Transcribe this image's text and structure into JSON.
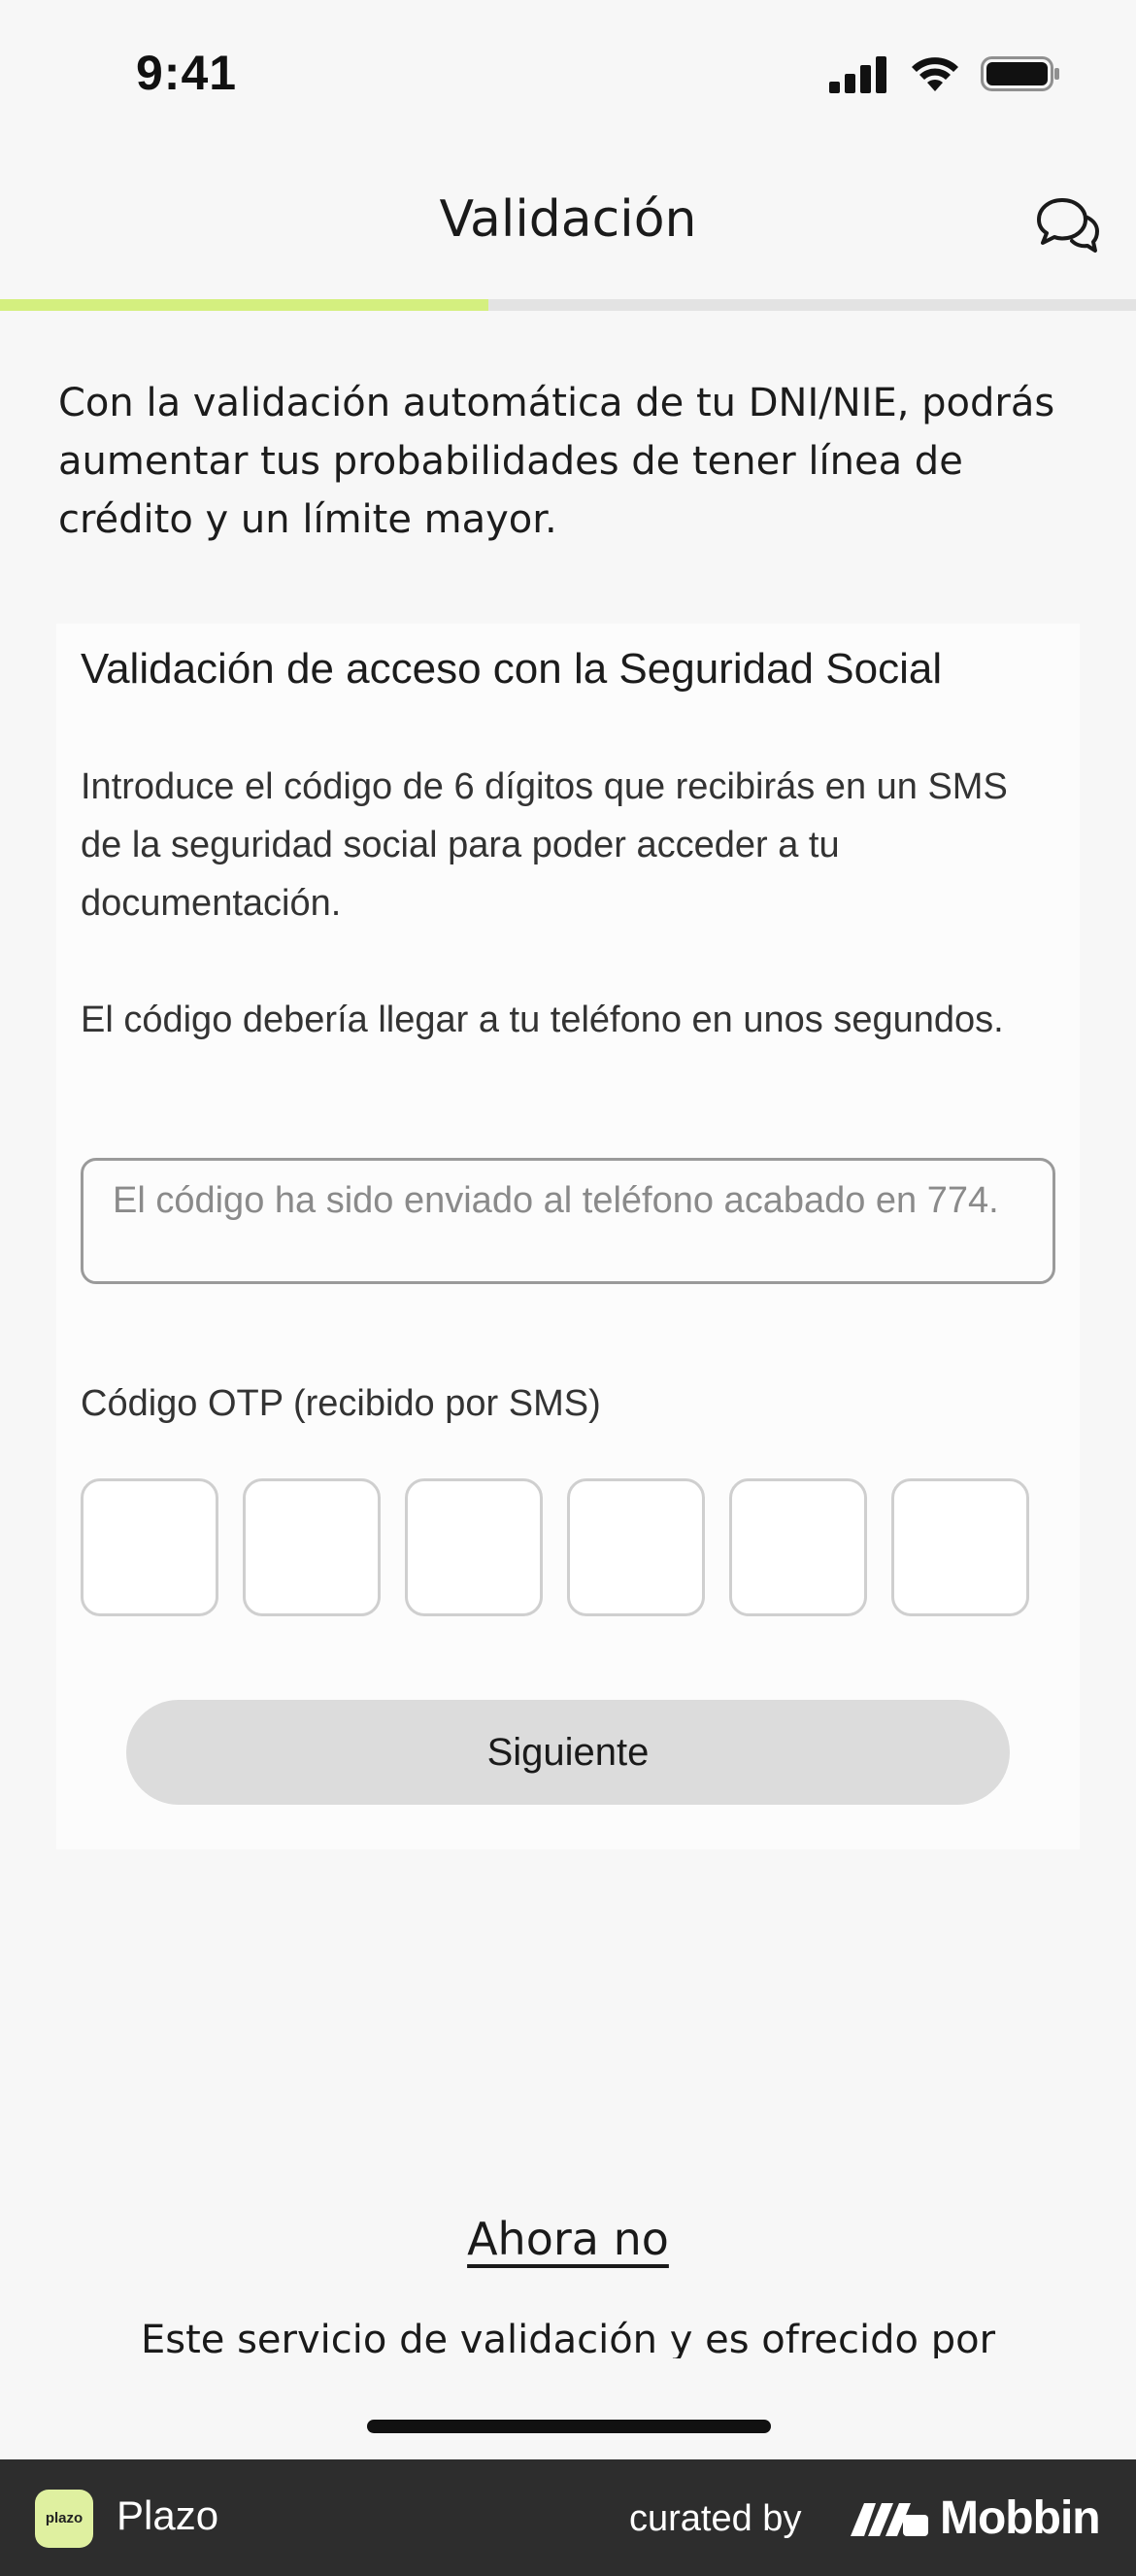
{
  "status_bar": {
    "time": "9:41"
  },
  "nav": {
    "title": "Validación"
  },
  "progress": {
    "fraction": 0.43
  },
  "intro": {
    "text": "Con la validación automática de tu DNI/NIE, podrás aumentar tus probabilidades de tener línea de crédito y un límite mayor."
  },
  "card": {
    "title": "Validación de acceso con la Seguridad Social",
    "paragraph1": "Introduce el código de 6 dígitos que recibirás en un SMS de la seguridad social para poder acceder a tu documentación.",
    "paragraph2": "El código debería llegar a tu teléfono en unos segundos.",
    "info": "El código ha sido enviado al teléfono acabado en 774.",
    "otp_label": "Código OTP (recibido por SMS)",
    "otp_values": [
      "",
      "",
      "",
      "",
      "",
      ""
    ],
    "next_label": "Siguiente"
  },
  "later_label": "Ahora no",
  "footer_note": "Este servicio de validación y es ofrecido por",
  "mobbin_bar": {
    "app_badge": "plazo",
    "app_name": "Plazo",
    "curated_by": "curated by",
    "brand": "Mobbin"
  },
  "colors": {
    "accent": "#d4ef7f",
    "button_disabled": "#dcdcdc",
    "footer_bg": "#2d2d2d"
  }
}
